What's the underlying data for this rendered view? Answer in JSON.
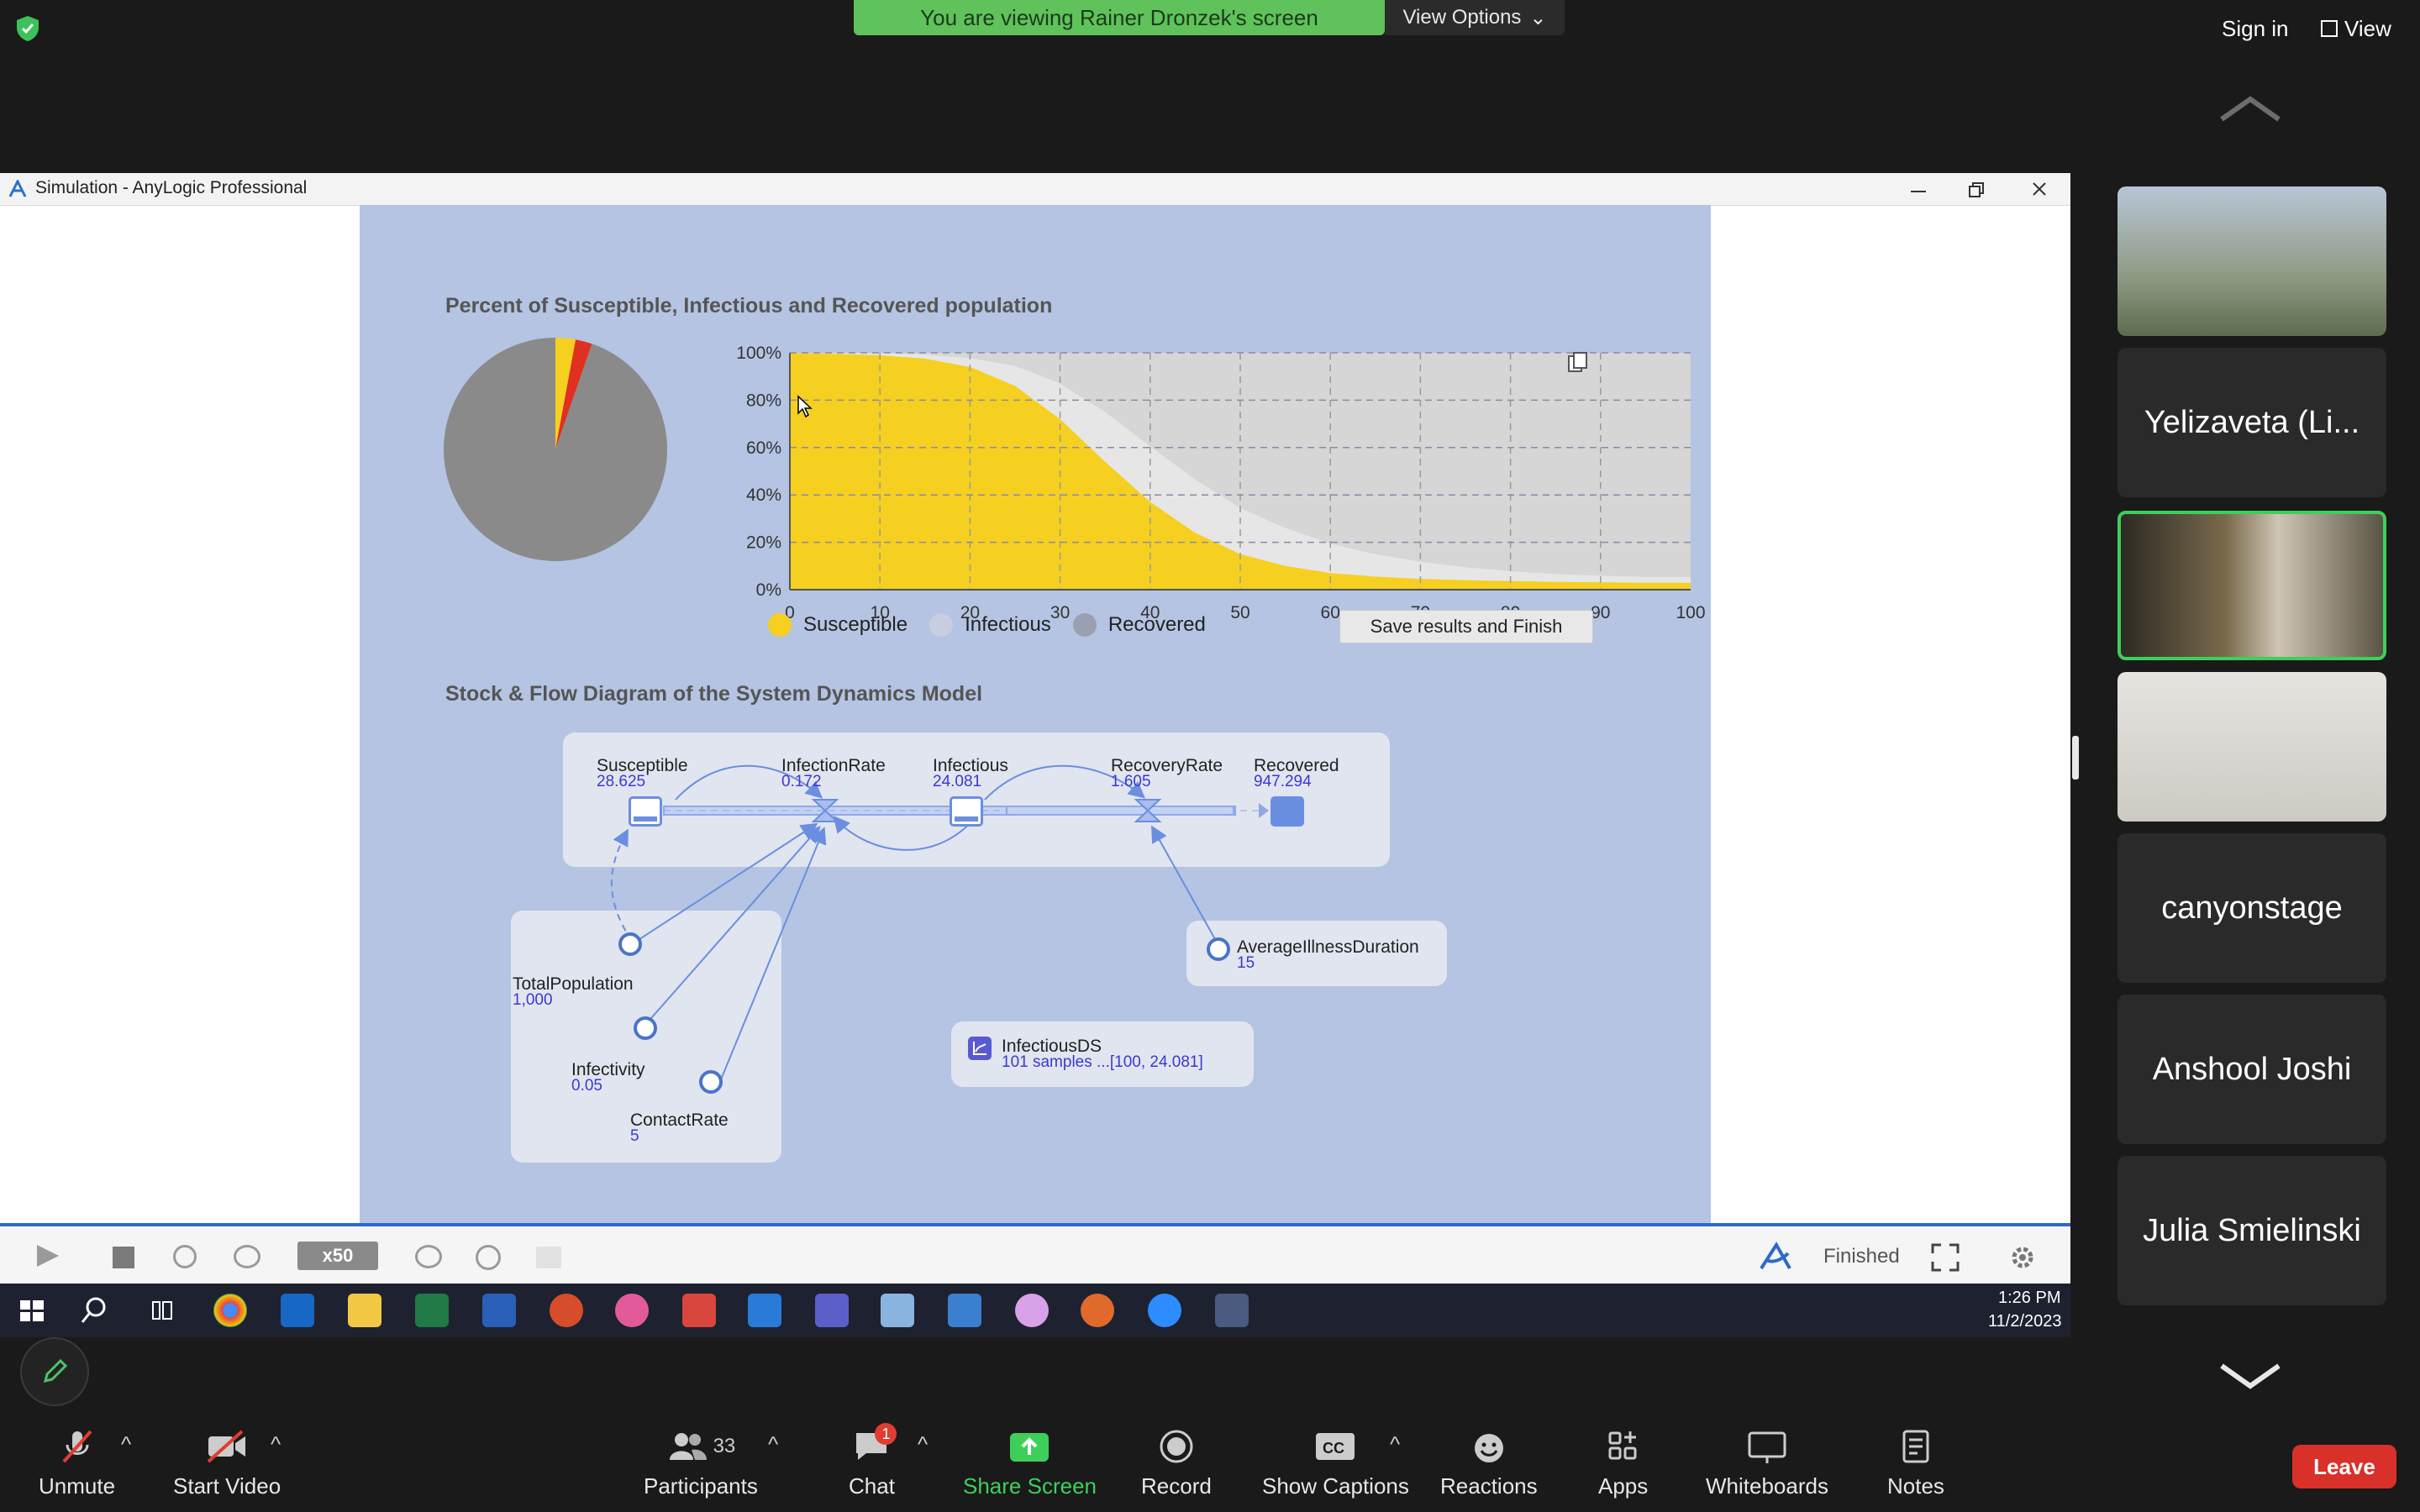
{
  "zoom": {
    "banner": "You are viewing Rainer Dronzek's screen",
    "view_options": "View Options",
    "sign_in": "Sign in",
    "view": "View"
  },
  "window": {
    "title": "Simulation - AnyLogic Professional"
  },
  "chart_section": {
    "title": "Percent of Susceptible, Infectious and Recovered population",
    "save_button": "Save results and Finish",
    "legend": [
      {
        "label": "Susceptible",
        "color": "#f5d020"
      },
      {
        "label": "Infectious",
        "color": "#c8cedf"
      },
      {
        "label": "Recovered",
        "color": "#9aa0b0"
      }
    ],
    "y_ticks": [
      "100%",
      "80%",
      "60%",
      "40%",
      "20%",
      "0%"
    ],
    "x_ticks": [
      "0",
      "10",
      "20",
      "30",
      "40",
      "50",
      "60",
      "70",
      "80",
      "90",
      "100"
    ]
  },
  "chart_data": [
    {
      "type": "area",
      "title": "Percent of Susceptible, Infectious and Recovered population",
      "xlabel": "",
      "ylabel": "",
      "xlim": [
        0,
        100
      ],
      "ylim": [
        0,
        100
      ],
      "x": [
        0,
        5,
        10,
        15,
        20,
        25,
        30,
        35,
        40,
        45,
        50,
        55,
        60,
        65,
        70,
        75,
        80,
        85,
        90,
        95,
        100
      ],
      "series": [
        {
          "name": "Susceptible",
          "color": "#f5d020",
          "values": [
            99.9,
            99.6,
            99.0,
            97.5,
            94.0,
            86.0,
            72.0,
            54.0,
            37.0,
            24.0,
            15.0,
            10.0,
            7.0,
            5.5,
            4.5,
            4.0,
            3.6,
            3.3,
            3.1,
            2.9,
            2.9
          ]
        },
        {
          "name": "Infectious",
          "color": "#e6e6e6",
          "values": [
            0.1,
            0.3,
            0.7,
            1.7,
            3.8,
            8.5,
            15.0,
            21.0,
            23.5,
            22.5,
            19.5,
            16.0,
            12.5,
            9.5,
            7.3,
            5.5,
            4.2,
            3.3,
            2.8,
            2.5,
            2.4
          ]
        },
        {
          "name": "Recovered",
          "color": "#d6d6d6",
          "values": [
            0,
            0.1,
            0.3,
            0.8,
            2.2,
            5.5,
            13.0,
            25.0,
            39.5,
            53.5,
            65.5,
            74.0,
            80.5,
            85.0,
            88.2,
            90.5,
            92.2,
            93.4,
            94.1,
            94.6,
            94.7
          ]
        }
      ],
      "grid": true
    },
    {
      "type": "pie",
      "labels": [
        "Susceptible",
        "Infectious",
        "Recovered"
      ],
      "values": [
        2.9,
        2.4,
        94.7
      ],
      "colors": [
        "#f5d020",
        "#e03020",
        "#8a8a8a"
      ]
    }
  ],
  "sd_section": {
    "title": "Stock & Flow Diagram of the System Dynamics Model",
    "nodes": {
      "susceptible": {
        "label": "Susceptible",
        "value": "28.625"
      },
      "infection_rate": {
        "label": "InfectionRate",
        "value": "0.172"
      },
      "infectious": {
        "label": "Infectious",
        "value": "24.081"
      },
      "recovery_rate": {
        "label": "RecoveryRate",
        "value": "1.605"
      },
      "recovered": {
        "label": "Recovered",
        "value": "947.294"
      },
      "total_population": {
        "label": "TotalPopulation",
        "value": "1,000"
      },
      "infectivity": {
        "label": "Infectivity",
        "value": "0.05"
      },
      "contact_rate": {
        "label": "ContactRate",
        "value": "5"
      },
      "avg_illness": {
        "label": "AverageIllnessDuration",
        "value": "15"
      },
      "infectious_ds": {
        "label": "InfectiousDS",
        "value": "101 samples ...[100, 24.081]"
      }
    }
  },
  "sim_toolbar": {
    "speed": "x50",
    "status": "Finished"
  },
  "taskbar": {
    "time": "1:26 PM",
    "date": "11/2/2023"
  },
  "participants": [
    {
      "name": ""
    },
    {
      "name": "Yelizaveta (Li..."
    },
    {
      "name": ""
    },
    {
      "name": ""
    },
    {
      "name": "canyonstage"
    },
    {
      "name": "Anshool Joshi"
    },
    {
      "name": "Julia Smielinski"
    }
  ],
  "bottom_bar": {
    "unmute": "Unmute",
    "start_video": "Start Video",
    "participants": "Participants",
    "participants_count": "33",
    "chat": "Chat",
    "chat_badge": "1",
    "share_screen": "Share Screen",
    "record": "Record",
    "show_captions": "Show Captions",
    "reactions": "Reactions",
    "apps": "Apps",
    "whiteboards": "Whiteboards",
    "notes": "Notes",
    "leave": "Leave"
  }
}
